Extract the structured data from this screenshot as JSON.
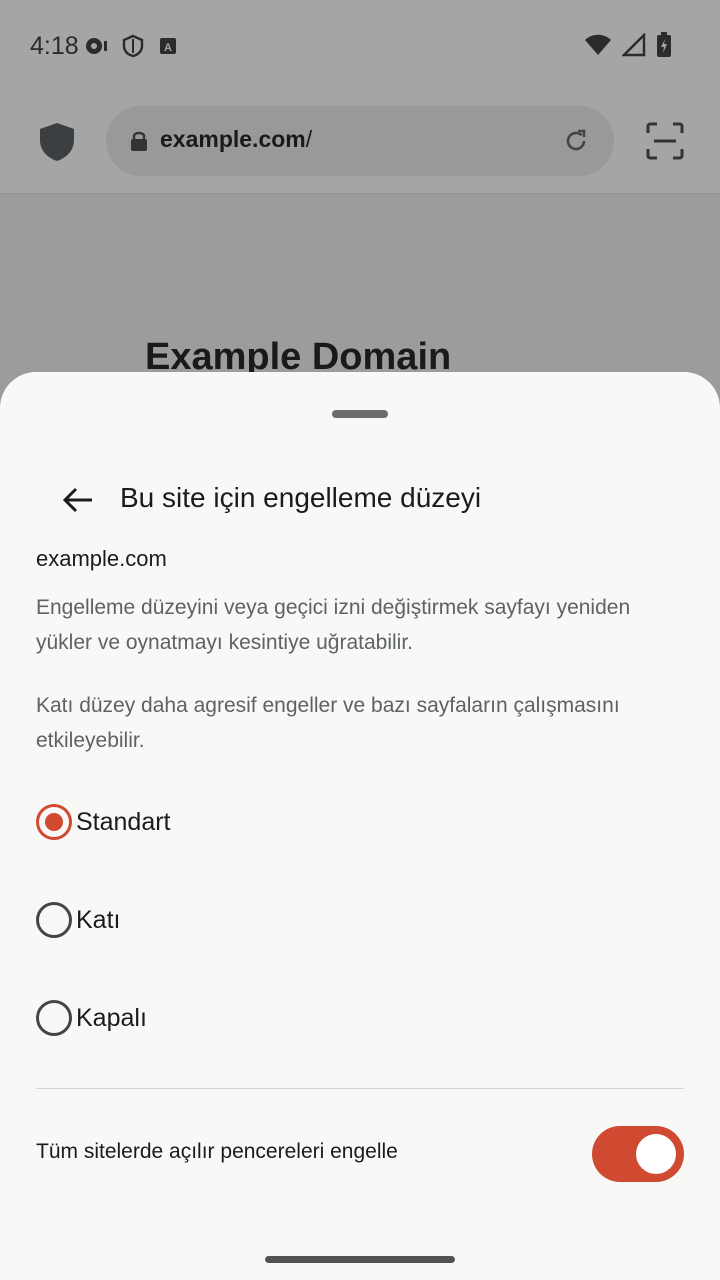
{
  "status_bar": {
    "time": "4:18"
  },
  "browser": {
    "url_host": "example.com",
    "url_path": "/",
    "page_heading": "Example Domain"
  },
  "sheet": {
    "title": "Bu site için engelleme düzeyi",
    "site": "example.com",
    "description_1": "Engelleme düzeyini veya geçici izni değiştirmek sayfayı yeniden yükler ve oynatmayı kesintiye uğratabilir.",
    "description_2": "Katı düzey daha agresif engeller ve bazı sayfaların çalışmasını etkileyebilir.",
    "options": [
      {
        "label": "Standart",
        "selected": true
      },
      {
        "label": "Katı",
        "selected": false
      },
      {
        "label": "Kapalı",
        "selected": false
      }
    ],
    "popup_toggle": {
      "label": "Tüm sitelerde açılır pencereleri engelle",
      "on": true
    }
  },
  "colors": {
    "accent": "#d04a31",
    "sheet_bg": "#f8f8f6",
    "scrim": "#9c9c9c"
  }
}
